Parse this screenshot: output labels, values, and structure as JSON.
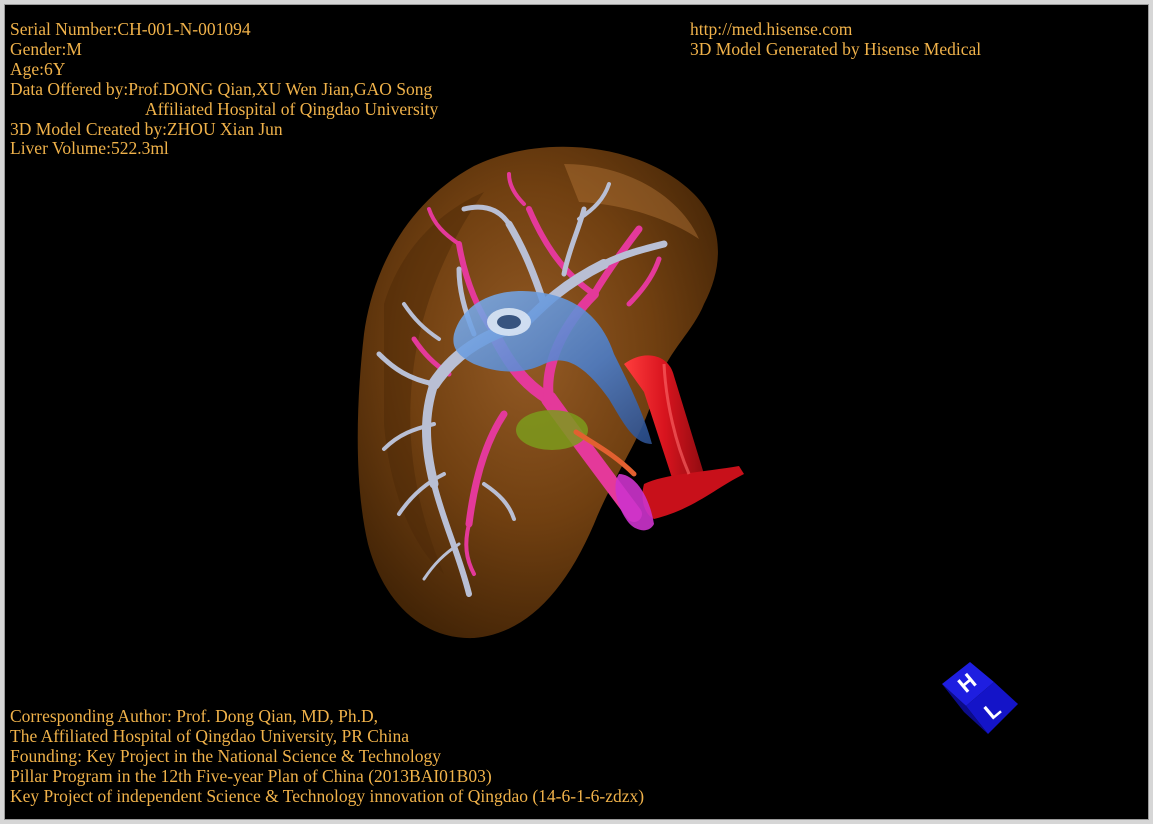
{
  "header_left": {
    "serial": "Serial Number:CH-001-N-001094",
    "gender": "Gender:M",
    "age": "Age:6Y",
    "data_offered": "Data Offered by:Prof.DONG Qian,XU Wen Jian,GAO Song",
    "hospital": "Affiliated Hospital of Qingdao University",
    "created_by": "3D Model Created by:ZHOU Xian Jun",
    "liver_volume": "Liver Volume:522.3ml"
  },
  "header_right": {
    "url": "http://med.hisense.com",
    "generated_by": "3D Model Generated by Hisense Medical"
  },
  "footer": {
    "line1": "Corresponding Author: Prof. Dong Qian, MD, Ph.D,",
    "line2": "The Affiliated Hospital of Qingdao University, PR China",
    "line3": "Founding: Key Project in the National Science & Technology",
    "line4": "Pillar Program in the 12th Five-year Plan of China (2013BAI01B03)",
    "line5": "Key Project of independent Science & Technology innovation of Qingdao (14-6-1-6-zdzx)"
  },
  "orientation_cube": {
    "face_top": "H",
    "face_front": "L"
  },
  "colors": {
    "background": "#000000",
    "text": "#f0b24a",
    "liver": "#7a4512",
    "hepatic_vein": "#b9bfd4",
    "portal_vein": "#e4399a",
    "inferior_vena_cava": "#5b8ed6",
    "artery": "#d8141e",
    "gallbladder": "#7c9a1c",
    "cube": "#1414c8"
  }
}
